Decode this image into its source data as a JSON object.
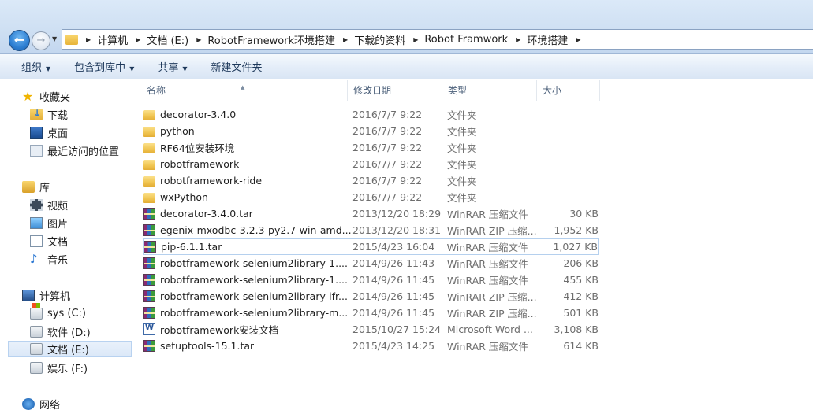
{
  "address": {
    "crumbs": [
      "计算机",
      "文档 (E:)",
      "RobotFramework环境搭建",
      "下载的资料",
      "Robot Framwork",
      "环境搭建"
    ]
  },
  "toolbar": {
    "organize": "组织",
    "include_in_library": "包含到库中",
    "share": "共享",
    "new_folder": "新建文件夹"
  },
  "nav": {
    "favorites": "收藏夹",
    "downloads": "下载",
    "desktop": "桌面",
    "recent": "最近访问的位置",
    "libraries": "库",
    "videos": "视频",
    "pictures": "图片",
    "documents": "文档",
    "music": "音乐",
    "computer": "计算机",
    "drive_c": "sys (C:)",
    "drive_d": "软件 (D:)",
    "drive_e": "文档 (E:)",
    "drive_f": "娱乐 (F:)",
    "network": "网络"
  },
  "columns": {
    "name": "名称",
    "date": "修改日期",
    "type": "类型",
    "size": "大小"
  },
  "files": [
    {
      "name": "decorator-3.4.0",
      "date": "2016/7/7 9:22",
      "type": "文件夹",
      "size": "",
      "icon": "folder-icon"
    },
    {
      "name": "python",
      "date": "2016/7/7 9:22",
      "type": "文件夹",
      "size": "",
      "icon": "folder-icon"
    },
    {
      "name": "RF64位安装环境",
      "date": "2016/7/7 9:22",
      "type": "文件夹",
      "size": "",
      "icon": "folder-icon"
    },
    {
      "name": "robotframework",
      "date": "2016/7/7 9:22",
      "type": "文件夹",
      "size": "",
      "icon": "folder-icon"
    },
    {
      "name": "robotframework-ride",
      "date": "2016/7/7 9:22",
      "type": "文件夹",
      "size": "",
      "icon": "folder-icon"
    },
    {
      "name": "wxPython",
      "date": "2016/7/7 9:22",
      "type": "文件夹",
      "size": "",
      "icon": "folder-icon"
    },
    {
      "name": "decorator-3.4.0.tar",
      "date": "2013/12/20 18:29",
      "type": "WinRAR 压缩文件",
      "size": "30 KB",
      "icon": "rar-icon"
    },
    {
      "name": "egenix-mxodbc-3.2.3-py2.7-win-amd...",
      "date": "2013/12/20 18:31",
      "type": "WinRAR ZIP 压缩...",
      "size": "1,952 KB",
      "icon": "rar-icon"
    },
    {
      "name": "pip-6.1.1.tar",
      "date": "2015/4/23 16:04",
      "type": "WinRAR 压缩文件",
      "size": "1,027 KB",
      "icon": "rar-icon"
    },
    {
      "name": "robotframework-selenium2library-1....",
      "date": "2014/9/26 11:43",
      "type": "WinRAR 压缩文件",
      "size": "206 KB",
      "icon": "rar-icon"
    },
    {
      "name": "robotframework-selenium2library-1....",
      "date": "2014/9/26 11:45",
      "type": "WinRAR 压缩文件",
      "size": "455 KB",
      "icon": "rar-icon"
    },
    {
      "name": "robotframework-selenium2library-ifr...",
      "date": "2014/9/26 11:45",
      "type": "WinRAR ZIP 压缩...",
      "size": "412 KB",
      "icon": "rar-icon"
    },
    {
      "name": "robotframework-selenium2library-m...",
      "date": "2014/9/26 11:45",
      "type": "WinRAR ZIP 压缩...",
      "size": "501 KB",
      "icon": "rar-icon"
    },
    {
      "name": "robotframework安装文档",
      "date": "2015/10/27 15:24",
      "type": "Microsoft Word ...",
      "size": "3,108 KB",
      "icon": "word-icon"
    },
    {
      "name": "setuptools-15.1.tar",
      "date": "2015/4/23 14:25",
      "type": "WinRAR 压缩文件",
      "size": "614 KB",
      "icon": "rar-icon"
    }
  ]
}
